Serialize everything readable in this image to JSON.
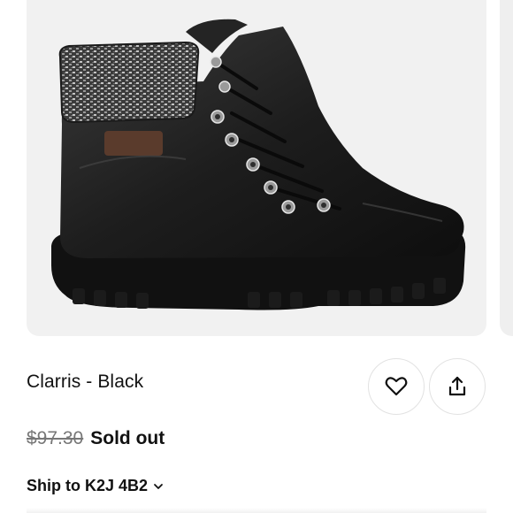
{
  "product": {
    "image_alt": "black lace-up hiking boot with knit collar",
    "title": "Clarris - Black",
    "original_price": "$97.30",
    "status": "Sold out"
  },
  "actions": {
    "favorite_icon": "heart-icon",
    "share_icon": "share-icon"
  },
  "shipping": {
    "label": "Ship to K2J 4B2",
    "chevron_icon": "chevron-down-icon"
  },
  "colors": {
    "card_background": "#f1f1f1",
    "text_primary": "#111111",
    "text_muted": "#777777",
    "border": "#e2e2e2"
  }
}
